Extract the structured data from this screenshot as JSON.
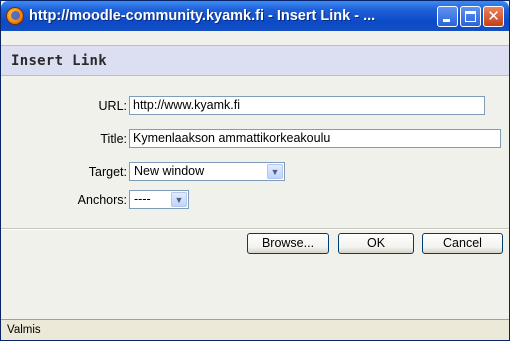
{
  "window": {
    "title": "http://moodle-community.kyamk.fi - Insert Link - ...",
    "close_glyph": "✕"
  },
  "dialog": {
    "heading": "Insert Link"
  },
  "form": {
    "url_label": "URL:",
    "url_value": "http://www.kyamk.fi",
    "title_label": "Title:",
    "title_value": "Kymenlaakson ammattikorkeakoulu",
    "target_label": "Target:",
    "target_value": "New window",
    "anchors_label": "Anchors:",
    "anchors_value": "----"
  },
  "buttons": {
    "browse": "Browse...",
    "ok": "OK",
    "cancel": "Cancel"
  },
  "status": {
    "text": "Valmis"
  },
  "icons": {
    "app": "firefox-icon",
    "dropdown": "chevron-down-icon"
  }
}
